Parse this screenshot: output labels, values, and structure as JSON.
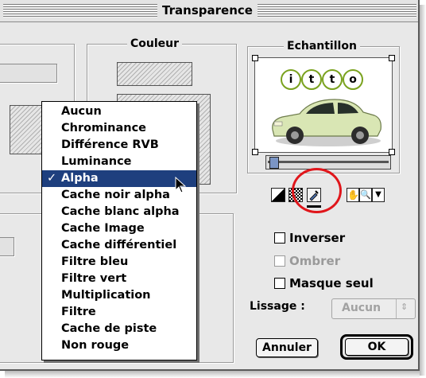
{
  "window": {
    "title": "Transparence"
  },
  "groups": {
    "couleur": "Couleur",
    "echantillon": "Echantillon"
  },
  "sample_logo": [
    "i",
    "t",
    "t",
    "o"
  ],
  "tools": {
    "icons": [
      "contrast-icon",
      "checkerboard-icon",
      "eyedropper-icon",
      "hand-icon",
      "zoom-icon",
      "arrow-down-menu-icon"
    ]
  },
  "checkboxes": [
    {
      "label": "Inverser",
      "checked": false,
      "enabled": true
    },
    {
      "label": "Ombrer",
      "checked": false,
      "enabled": false
    },
    {
      "label": "Masque seul",
      "checked": false,
      "enabled": true
    }
  ],
  "lissage": {
    "label": "Lissage :",
    "value": "Aucun"
  },
  "buttons": {
    "cancel": "Annuler",
    "ok": "OK"
  },
  "menu": {
    "check_mark": "✓",
    "selected": "Alpha",
    "items": [
      "Aucun",
      "Chrominance",
      "Différence RVB",
      "Luminance",
      "Alpha",
      "Cache noir alpha",
      "Cache blanc alpha",
      "Cache Image",
      "Cache différentiel",
      "Filtre bleu",
      "Filtre vert",
      "Multiplication",
      "Filtre",
      "Cache de piste",
      "Non rouge"
    ]
  },
  "colors": {
    "highlight": "#1e3f7e",
    "annotation_ring": "#e0161b",
    "logo_green": "#7aa21e"
  }
}
